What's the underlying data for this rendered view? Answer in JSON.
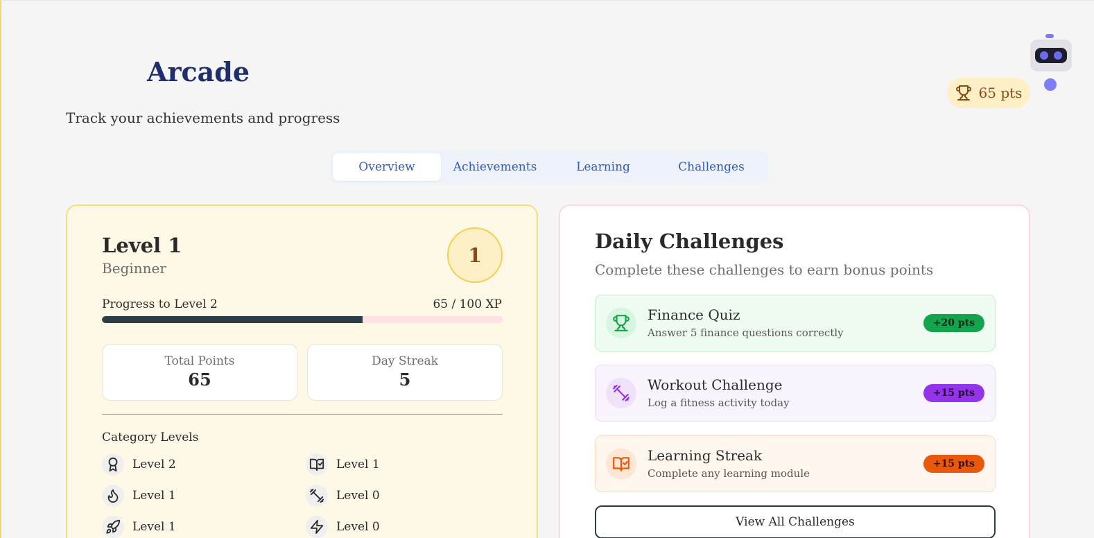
{
  "header": {
    "title": "Arcade",
    "subtitle": "Track your achievements and progress",
    "points_badge": "65 pts"
  },
  "tabs": [
    {
      "label": "Overview",
      "active": true
    },
    {
      "label": "Achievements",
      "active": false
    },
    {
      "label": "Learning",
      "active": false
    },
    {
      "label": "Challenges",
      "active": false
    }
  ],
  "level_card": {
    "title": "Level 1",
    "rank": "Beginner",
    "badge_number": "1",
    "progress_label": "Progress to Level 2",
    "progress_text": "65 / 100 XP",
    "progress_fraction": 0.65,
    "stats": [
      {
        "label": "Total Points",
        "value": "65"
      },
      {
        "label": "Day Streak",
        "value": "5"
      }
    ],
    "category_heading": "Category Levels",
    "categories": [
      {
        "icon": "award-icon",
        "label": "Level 2"
      },
      {
        "icon": "book-check-icon",
        "label": "Level 1"
      },
      {
        "icon": "flame-icon",
        "label": "Level 1"
      },
      {
        "icon": "dumbbell-icon",
        "label": "Level 0"
      },
      {
        "icon": "rocket-icon",
        "label": "Level 1"
      },
      {
        "icon": "zap-icon",
        "label": "Level 0"
      }
    ]
  },
  "daily_challenges": {
    "title": "Daily Challenges",
    "subtitle": "Complete these challenges to earn bonus points",
    "items": [
      {
        "icon": "trophy-icon",
        "name": "Finance Quiz",
        "description": "Answer 5 finance questions correctly",
        "points": "+20 pts",
        "color": "#14a44d"
      },
      {
        "icon": "dumbbell-icon",
        "name": "Workout Challenge",
        "description": "Log a fitness activity today",
        "points": "+15 pts",
        "color": "#9333ea"
      },
      {
        "icon": "book-check-icon",
        "name": "Learning Streak",
        "description": "Complete any learning module",
        "points": "+15 pts",
        "color": "#ea580c"
      }
    ],
    "view_all_label": "View All Challenges"
  },
  "colors": {
    "accent": "#2f5bc4",
    "title": "#1e2f6b",
    "progress_fill": "#2b3e46",
    "points_text": "#8a4a12"
  }
}
